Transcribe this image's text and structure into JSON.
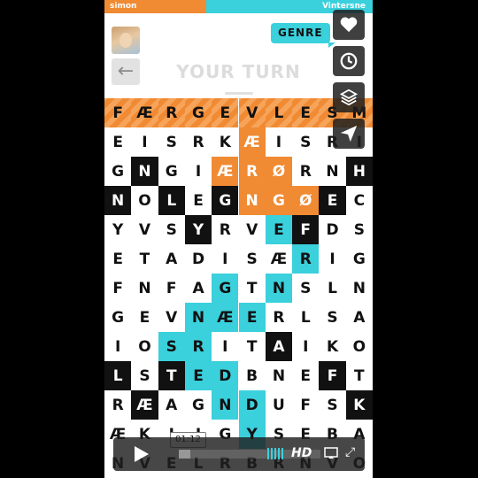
{
  "players": {
    "left": "simon",
    "right": "Vintersne"
  },
  "header": {
    "genre_label": "GENRE",
    "turn_label": "YOUR TURN",
    "back_icon": "arrow-left-icon"
  },
  "grid": {
    "rows": [
      [
        "F",
        "Æ",
        "R",
        "G",
        "E",
        "V",
        "L",
        "E",
        "S",
        "M"
      ],
      [
        "E",
        "I",
        "S",
        "R",
        "K",
        "Æ",
        "I",
        "S",
        "R",
        "I"
      ],
      [
        "G",
        "N",
        "G",
        "I",
        "Æ",
        "R",
        "Ø",
        "R",
        "N",
        "H"
      ],
      [
        "N",
        "O",
        "L",
        "E",
        "G",
        "N",
        "G",
        "Ø",
        "E",
        "C"
      ],
      [
        "Y",
        "V",
        "S",
        "Y",
        "R",
        "V",
        "E",
        "F",
        "D",
        "S"
      ],
      [
        "E",
        "T",
        "A",
        "D",
        "I",
        "S",
        "Æ",
        "R",
        "I",
        "G"
      ],
      [
        "F",
        "N",
        "F",
        "A",
        "G",
        "T",
        "N",
        "S",
        "L",
        "N"
      ],
      [
        "G",
        "E",
        "V",
        "N",
        "Æ",
        "E",
        "R",
        "L",
        "S",
        "A"
      ],
      [
        "I",
        "O",
        "S",
        "R",
        "I",
        "T",
        "A",
        "I",
        "K",
        "O"
      ],
      [
        "L",
        "S",
        "T",
        "E",
        "D",
        "B",
        "N",
        "E",
        "F",
        "T"
      ],
      [
        "R",
        "Æ",
        "A",
        "G",
        "N",
        "D",
        "U",
        "F",
        "S",
        "K"
      ],
      [
        "Æ",
        "K",
        "I",
        "I",
        "G",
        "Y",
        "S",
        "E",
        "B",
        "A"
      ],
      [
        "N",
        "V",
        "E",
        "L",
        "R",
        "B",
        "R",
        "N",
        "V",
        "O"
      ]
    ],
    "styles": [
      [
        "s",
        "s",
        "s",
        "s",
        "s",
        "s",
        "s",
        "s",
        "s",
        "s"
      ],
      [
        "w",
        "w",
        "w",
        "w",
        "w",
        "o",
        "w",
        "w",
        "w",
        "w"
      ],
      [
        "w",
        "b",
        "w",
        "w",
        "o",
        "o",
        "o",
        "w",
        "w",
        "b"
      ],
      [
        "b",
        "w",
        "b",
        "w",
        "b",
        "o",
        "o",
        "o",
        "b",
        "w"
      ],
      [
        "w",
        "w",
        "w",
        "b",
        "w",
        "w",
        "c",
        "b",
        "w",
        "w"
      ],
      [
        "w",
        "w",
        "w",
        "w",
        "w",
        "w",
        "w",
        "c",
        "w",
        "w"
      ],
      [
        "w",
        "w",
        "w",
        "w",
        "c",
        "w",
        "c",
        "w",
        "w",
        "w"
      ],
      [
        "w",
        "w",
        "w",
        "c",
        "c",
        "c",
        "w",
        "w",
        "w",
        "w"
      ],
      [
        "w",
        "w",
        "c",
        "c",
        "w",
        "w",
        "b",
        "w",
        "w",
        "w"
      ],
      [
        "b",
        "w",
        "b",
        "c",
        "c",
        "w",
        "w",
        "w",
        "b",
        "w"
      ],
      [
        "w",
        "b",
        "w",
        "w",
        "c",
        "c",
        "w",
        "w",
        "w",
        "b"
      ],
      [
        "w",
        "w",
        "w",
        "w",
        "w",
        "c",
        "w",
        "w",
        "w",
        "w"
      ],
      [
        "w",
        "w",
        "w",
        "w",
        "w",
        "w",
        "w",
        "w",
        "w",
        "w"
      ]
    ]
  },
  "side_buttons": [
    {
      "name": "like-button",
      "icon": "heart-icon"
    },
    {
      "name": "watch-later-button",
      "icon": "clock-icon"
    },
    {
      "name": "collections-button",
      "icon": "layers-icon"
    },
    {
      "name": "share-button",
      "icon": "paper-plane-icon"
    }
  ],
  "player": {
    "time": "01:12",
    "progress": 0.08,
    "hd_label": "HD"
  },
  "colors": {
    "orange": "#f08a33",
    "cyan": "#3ad0dc",
    "black": "#111111"
  }
}
